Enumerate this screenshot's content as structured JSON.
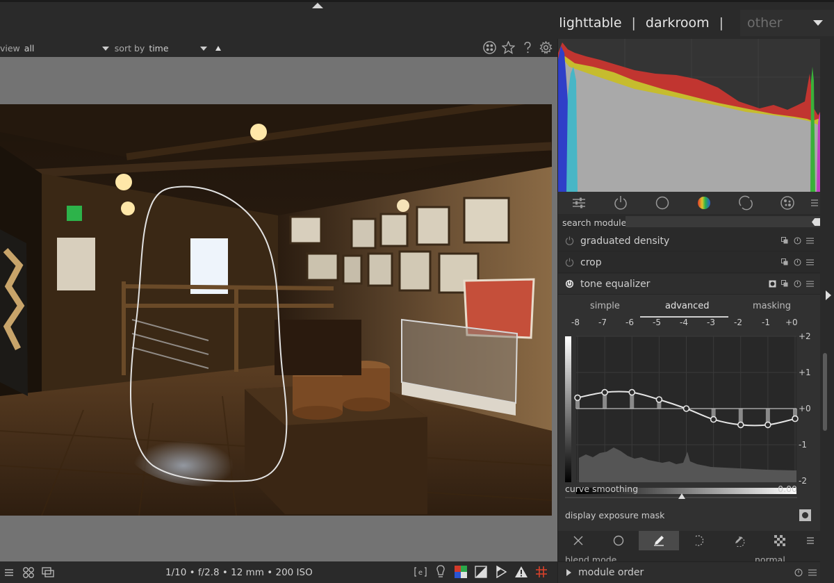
{
  "header": {
    "views": [
      "lighttable",
      "darkroom"
    ],
    "separator": "|",
    "other_label": "other"
  },
  "filter": {
    "view_label": "view",
    "view_value": "all",
    "sort_label": "sort by",
    "sort_value": "time"
  },
  "exif": {
    "text": "1/10 • f/2.8 • 12 mm • 200 ISO"
  },
  "search": {
    "label": "search module",
    "placeholder": ""
  },
  "modules": [
    {
      "name": "graduated density",
      "enabled": false
    },
    {
      "name": "crop",
      "enabled": false
    },
    {
      "name": "tone equalizer",
      "enabled": true
    }
  ],
  "tone_equalizer": {
    "tabs": [
      "simple",
      "advanced",
      "masking"
    ],
    "selected_tab": "advanced",
    "ev_labels": [
      "-8",
      "-7",
      "-6",
      "-5",
      "-4",
      "-3",
      "-2",
      "-1",
      "+0"
    ],
    "y_labels": [
      "+2",
      "+1",
      "+0",
      "-1",
      "-2"
    ],
    "curve_points": [
      0.3,
      0.45,
      0.45,
      0.25,
      0.0,
      -0.3,
      -0.45,
      -0.45,
      -0.28
    ],
    "curve_smoothing_label": "curve smoothing",
    "curve_smoothing_value": "0.00",
    "display_mask_label": "display exposure mask"
  },
  "blend": {
    "mode_label": "blend mode",
    "mode_value": "normal"
  },
  "module_order_label": "module order",
  "colors": {
    "accent": "#cfcfcf",
    "background": "#2a2a2a",
    "histogram_red": "#c8302a",
    "histogram_yellow": "#c9c030",
    "histogram_blue": "#2f3fc8",
    "histogram_cyan": "#4ab8c8"
  }
}
